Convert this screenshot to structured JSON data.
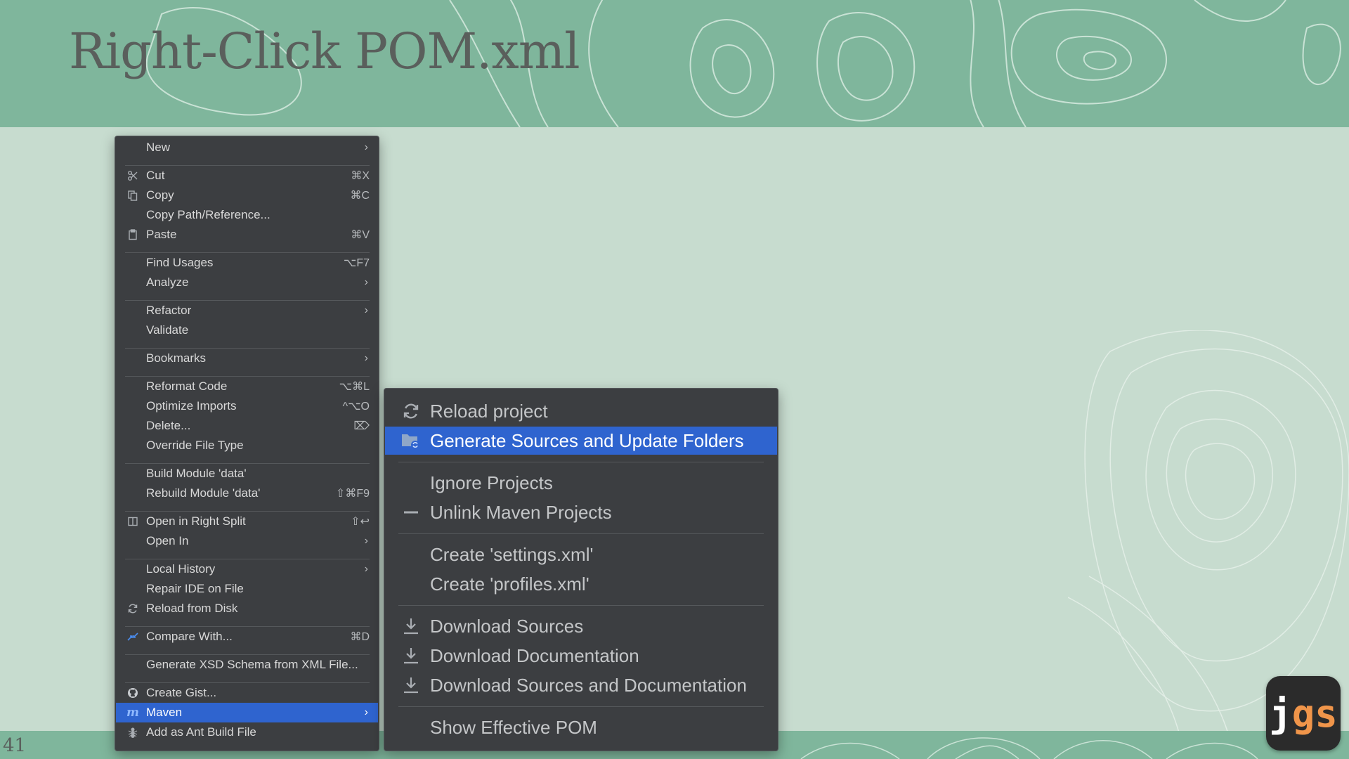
{
  "slide": {
    "title": "Right-Click POM.xml",
    "page_number": "41",
    "logo_j": "j",
    "logo_gs": "gs",
    "colors": {
      "band": "#7fb69c",
      "background": "#c7dccf",
      "menu_bg": "#3c3e41",
      "selection": "#2f64cf",
      "logo_accent": "#f0954a"
    }
  },
  "menu": {
    "items": [
      {
        "label": "New",
        "icon": "",
        "shortcut": "",
        "arrow": "›"
      },
      {
        "label": "Cut",
        "icon": "scissors-icon",
        "shortcut": "⌘X",
        "arrow": ""
      },
      {
        "label": "Copy",
        "icon": "copy-icon",
        "shortcut": "⌘C",
        "arrow": ""
      },
      {
        "label": "Copy Path/Reference...",
        "icon": "",
        "shortcut": "",
        "arrow": ""
      },
      {
        "label": "Paste",
        "icon": "clipboard-icon",
        "shortcut": "⌘V",
        "arrow": ""
      },
      {
        "label": "Find Usages",
        "icon": "",
        "shortcut": "⌥F7",
        "arrow": ""
      },
      {
        "label": "Analyze",
        "icon": "",
        "shortcut": "",
        "arrow": "›"
      },
      {
        "label": "Refactor",
        "icon": "",
        "shortcut": "",
        "arrow": "›"
      },
      {
        "label": "Validate",
        "icon": "",
        "shortcut": "",
        "arrow": ""
      },
      {
        "label": "Bookmarks",
        "icon": "",
        "shortcut": "",
        "arrow": "›"
      },
      {
        "label": "Reformat Code",
        "icon": "",
        "shortcut": "⌥⌘L",
        "arrow": ""
      },
      {
        "label": "Optimize Imports",
        "icon": "",
        "shortcut": "^⌥O",
        "arrow": ""
      },
      {
        "label": "Delete...",
        "icon": "",
        "shortcut": "⌦",
        "arrow": ""
      },
      {
        "label": "Override File Type",
        "icon": "",
        "shortcut": "",
        "arrow": ""
      },
      {
        "label": "Build Module 'data'",
        "icon": "",
        "shortcut": "",
        "arrow": ""
      },
      {
        "label": "Rebuild Module 'data'",
        "icon": "",
        "shortcut": "⇧⌘F9",
        "arrow": ""
      },
      {
        "label": "Open in Right Split",
        "icon": "split-icon",
        "shortcut": "⇧↩",
        "arrow": ""
      },
      {
        "label": "Open In",
        "icon": "",
        "shortcut": "",
        "arrow": "›"
      },
      {
        "label": "Local History",
        "icon": "",
        "shortcut": "",
        "arrow": "›"
      },
      {
        "label": "Repair IDE on File",
        "icon": "",
        "shortcut": "",
        "arrow": ""
      },
      {
        "label": "Reload from Disk",
        "icon": "reload-icon",
        "shortcut": "",
        "arrow": ""
      },
      {
        "label": "Compare With...",
        "icon": "compare-icon",
        "shortcut": "⌘D",
        "arrow": ""
      },
      {
        "label": "Generate XSD Schema from XML File...",
        "icon": "",
        "shortcut": "",
        "arrow": ""
      },
      {
        "label": "Create Gist...",
        "icon": "github-icon",
        "shortcut": "",
        "arrow": ""
      },
      {
        "label": "Maven",
        "icon": "maven-icon",
        "shortcut": "",
        "arrow": "›"
      },
      {
        "label": "Add as Ant Build File",
        "icon": "ant-icon",
        "shortcut": "",
        "arrow": ""
      }
    ]
  },
  "submenu": {
    "items": [
      {
        "label": "Reload project",
        "icon": "reload-icon"
      },
      {
        "label": "Generate Sources and Update Folders",
        "icon": "folder-refresh-icon"
      },
      {
        "label": "Ignore Projects",
        "icon": ""
      },
      {
        "label": "Unlink Maven Projects",
        "icon": "minus-icon"
      },
      {
        "label": "Create 'settings.xml'",
        "icon": ""
      },
      {
        "label": "Create 'profiles.xml'",
        "icon": ""
      },
      {
        "label": "Download Sources",
        "icon": "download-icon"
      },
      {
        "label": "Download Documentation",
        "icon": "download-icon"
      },
      {
        "label": "Download Sources and Documentation",
        "icon": "download-icon"
      },
      {
        "label": "Show Effective POM",
        "icon": ""
      }
    ]
  }
}
